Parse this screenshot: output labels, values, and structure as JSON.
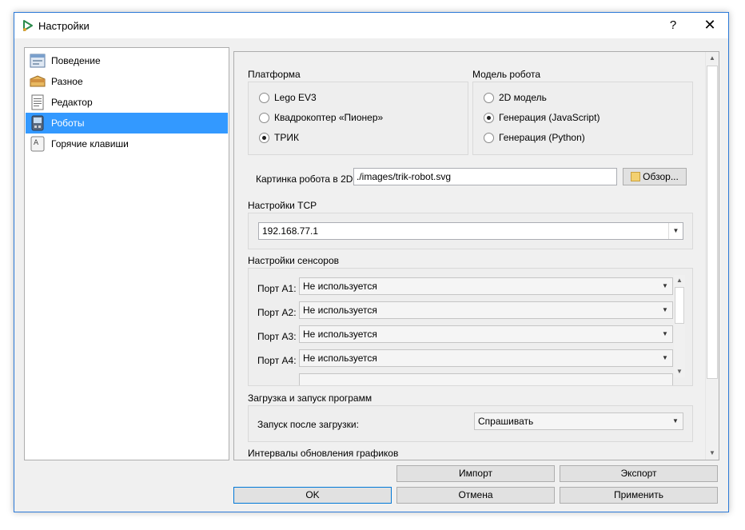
{
  "window": {
    "title": "Настройки",
    "help_glyph": "?",
    "close_glyph": "✕"
  },
  "sidebar": {
    "items": [
      {
        "label": "Поведение",
        "icon": "behavior-icon"
      },
      {
        "label": "Разное",
        "icon": "misc-icon"
      },
      {
        "label": "Редактор",
        "icon": "editor-icon"
      },
      {
        "label": "Роботы",
        "icon": "robots-icon",
        "selected": true
      },
      {
        "label": "Горячие клавиши",
        "icon": "hotkeys-icon"
      }
    ]
  },
  "platform": {
    "title": "Платформа",
    "options": [
      {
        "label": "Lego EV3",
        "checked": false
      },
      {
        "label": "Квадрокоптер «Пионер»",
        "checked": false
      },
      {
        "label": "ТРИК",
        "checked": true
      }
    ]
  },
  "robot_model": {
    "title": "Модель робота",
    "options": [
      {
        "label": "2D модель",
        "checked": false
      },
      {
        "label": "Генерация (JavaScript)",
        "checked": true
      },
      {
        "label": "Генерация (Python)",
        "checked": false
      }
    ]
  },
  "robot_image": {
    "label": "Картинка робота в 2D:",
    "value": "./images/trik-robot.svg",
    "browse_label": "Обзор..."
  },
  "tcp": {
    "title": "Настройки TCP",
    "value": "192.168.77.1"
  },
  "sensors": {
    "title": "Настройки сенсоров",
    "ports": [
      {
        "label": "Порт A1:",
        "value": "Не используется"
      },
      {
        "label": "Порт A2:",
        "value": "Не используется"
      },
      {
        "label": "Порт A3:",
        "value": "Не используется"
      },
      {
        "label": "Порт A4:",
        "value": "Не используется"
      }
    ]
  },
  "upload": {
    "title": "Загрузка и запуск программ",
    "label": "Запуск после загрузки:",
    "value": "Спрашивать"
  },
  "graphs": {
    "title": "Интервалы обновления графиков"
  },
  "buttons": {
    "import": "Импорт",
    "export": "Экспорт",
    "ok": "OK",
    "cancel": "Отмена",
    "apply": "Применить"
  },
  "colors": {
    "accent": "#3399ff",
    "arrow": "#1a9a3a",
    "window_border": "#2b79d7"
  }
}
